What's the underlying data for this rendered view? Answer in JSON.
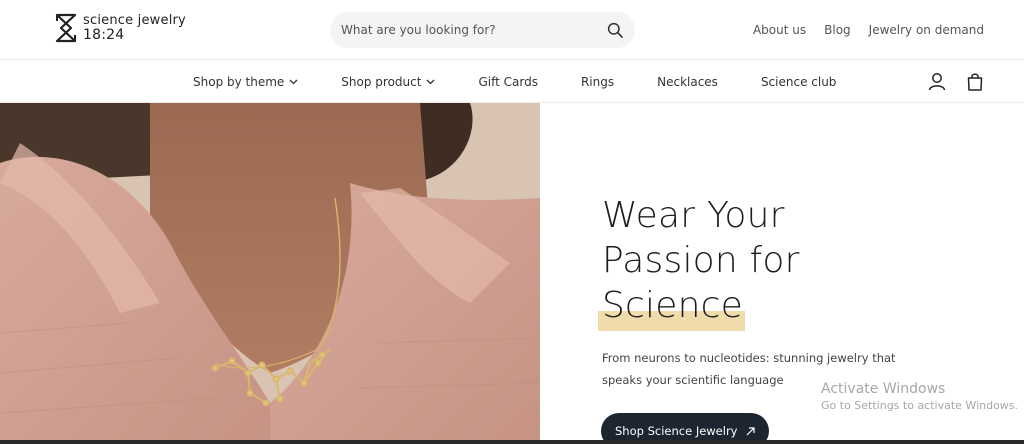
{
  "brand": {
    "name": "science jewelry",
    "time": "18:24",
    "logo_icon": "hourglass-logo-icon"
  },
  "search": {
    "placeholder": "What are you looking for?"
  },
  "top_links": [
    {
      "label": "About us"
    },
    {
      "label": "Blog"
    },
    {
      "label": "Jewelry on demand"
    }
  ],
  "nav": {
    "items": [
      {
        "label": "Shop by theme",
        "dropdown": true
      },
      {
        "label": "Shop product",
        "dropdown": true
      },
      {
        "label": "Gift Cards"
      },
      {
        "label": "Rings"
      },
      {
        "label": "Necklaces"
      },
      {
        "label": "Science club"
      }
    ],
    "icons": [
      "user-icon",
      "shopping-bag-icon"
    ]
  },
  "hero": {
    "headline_line1": "Wear Your",
    "headline_line2": "Passion for",
    "headline_highlight": "Science",
    "subtext_line1": "From neurons to nucleotides: stunning jewelry that",
    "subtext_line2": "speaks your scientific language",
    "cta_label": "Shop Science Jewelry",
    "highlight_color": "#efdcaa",
    "cta_color": "#1c2530"
  },
  "watermark": {
    "title": "Activate Windows",
    "subtitle": "Go to Settings to activate Windows."
  }
}
